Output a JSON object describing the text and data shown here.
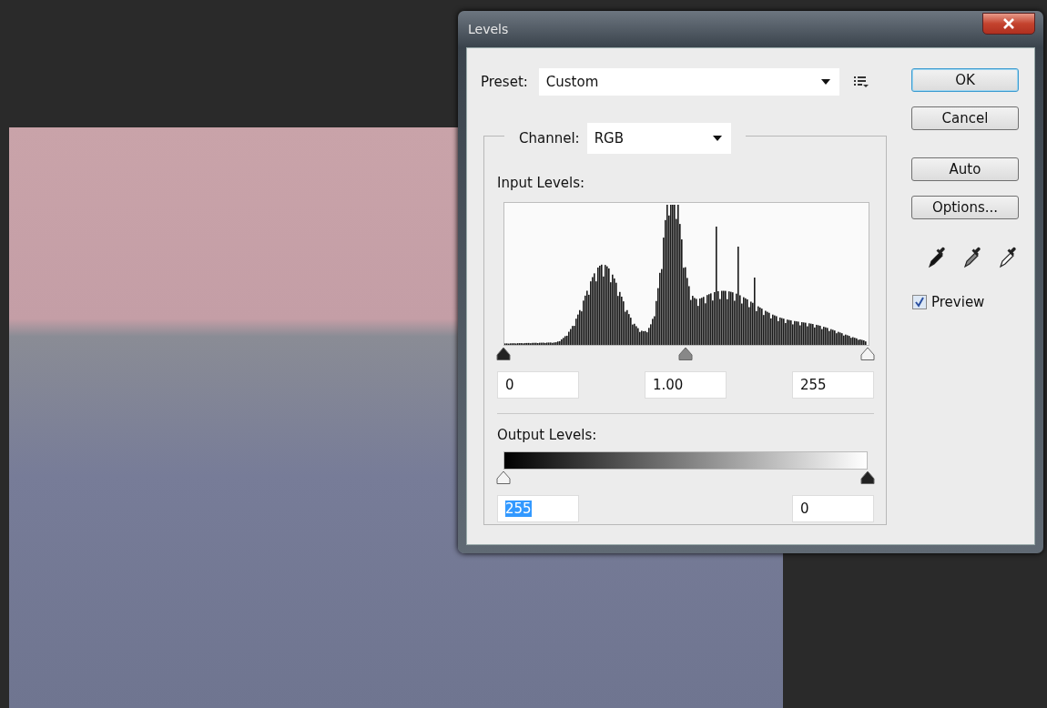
{
  "window": {
    "title": "Levels"
  },
  "preset": {
    "label": "Preset:",
    "value": "Custom"
  },
  "channel": {
    "label": "Channel:",
    "value": "RGB"
  },
  "input_levels": {
    "label": "Input Levels:",
    "thumbs": [
      {
        "kind": "shadow",
        "level": 0
      },
      {
        "kind": "midtone",
        "level": 0.5
      },
      {
        "kind": "highlight",
        "level": 1
      }
    ],
    "fields": [
      {
        "value": "0",
        "text_selected": false
      },
      {
        "value": "1.00",
        "text_selected": false
      },
      {
        "value": "255",
        "text_selected": false
      }
    ]
  },
  "output_levels": {
    "label": "Output Levels:",
    "thumbs": [
      {
        "kind": "highlight",
        "level": 0
      },
      {
        "kind": "shadow",
        "level": 1
      }
    ],
    "fields": [
      {
        "value": "255",
        "text_selected": true
      },
      {
        "value": "0",
        "text_selected": false
      }
    ]
  },
  "buttons": [
    {
      "label": "OK",
      "default": true
    },
    {
      "label": "Cancel",
      "default": false
    },
    {
      "label": "Auto",
      "default": false
    },
    {
      "label": "Options...",
      "default": false
    }
  ],
  "eyedroppers": [
    {
      "kind": "shadow"
    },
    {
      "kind": "midtone"
    },
    {
      "kind": "highlight"
    }
  ],
  "preview": {
    "label": "Preview",
    "checked": true
  }
}
